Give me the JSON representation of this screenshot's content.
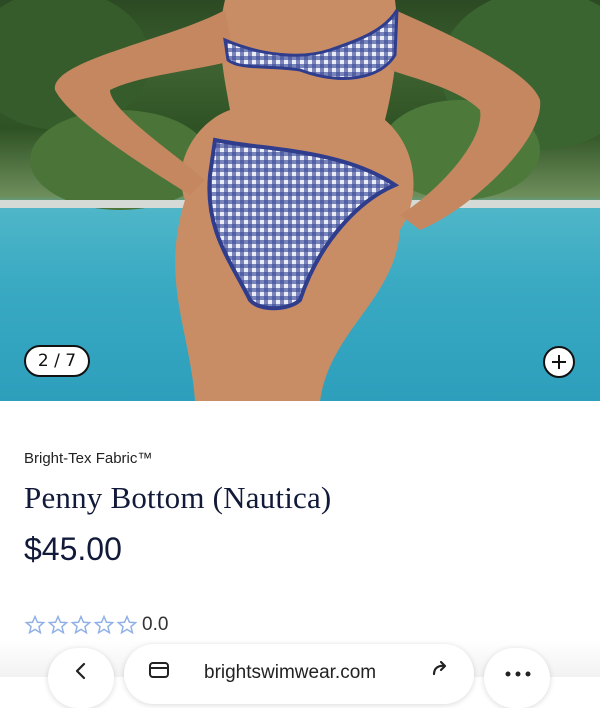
{
  "gallery": {
    "counter": "2 / 7",
    "zoom_icon": "plus-icon"
  },
  "product": {
    "fabric": "Bright-Tex Fabric™",
    "title": "Penny Bottom (Nautica)",
    "price": "$45.00"
  },
  "rating": {
    "value": "0.0",
    "stars": 5,
    "star_icon": "star-outline-icon",
    "star_color": "#8fb0e6"
  },
  "browser": {
    "url": "brightswimwear.com",
    "back_icon": "back-arrow-icon",
    "tabs_icon": "tabs-icon",
    "reload_icon": "reload-icon",
    "more_icon": "more-icon"
  }
}
